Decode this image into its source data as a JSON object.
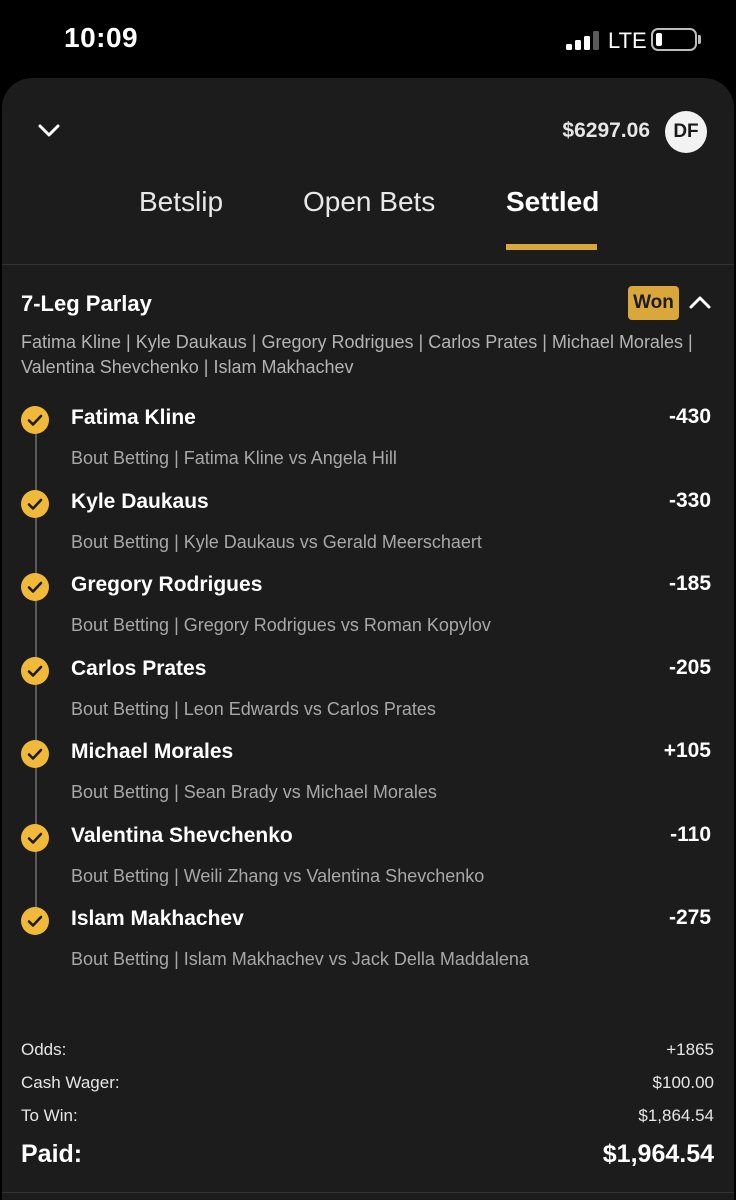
{
  "status_bar": {
    "time": "10:09",
    "network": "LTE"
  },
  "header": {
    "balance": "$6297.06",
    "avatar_initials": "DF"
  },
  "tabs": [
    {
      "label": "Betslip",
      "active": false
    },
    {
      "label": "Open Bets",
      "active": false
    },
    {
      "label": "Settled",
      "active": true
    }
  ],
  "parlay": {
    "title": "7-Leg Parlay",
    "status": "Won",
    "summary_line1": "Fatima Kline | Kyle Daukaus | Gregory Rodrigues | Carlos Prates | Michael Morales |",
    "summary_line2": "Valentina Shevchenko | Islam Makhachev",
    "legs": [
      {
        "name": "Fatima Kline",
        "odds": "-430",
        "description": "Bout Betting | Fatima Kline vs Angela Hill"
      },
      {
        "name": "Kyle Daukaus",
        "odds": "-330",
        "description": "Bout Betting | Kyle Daukaus vs Gerald Meerschaert"
      },
      {
        "name": "Gregory Rodrigues",
        "odds": "-185",
        "description": "Bout Betting | Gregory Rodrigues vs Roman Kopylov"
      },
      {
        "name": "Carlos Prates",
        "odds": "-205",
        "description": "Bout Betting | Leon Edwards vs Carlos Prates"
      },
      {
        "name": "Michael Morales",
        "odds": "+105",
        "description": "Bout Betting | Sean Brady vs Michael Morales"
      },
      {
        "name": "Valentina Shevchenko",
        "odds": "-110",
        "description": "Bout Betting | Weili Zhang vs Valentina Shevchenko"
      },
      {
        "name": "Islam Makhachev",
        "odds": "-275",
        "description": "Bout Betting | Islam Makhachev vs Jack Della Maddalena"
      }
    ]
  },
  "totals": {
    "odds_label": "Odds:",
    "odds_value": "+1865",
    "wager_label": "Cash Wager:",
    "wager_value": "$100.00",
    "to_win_label": "To Win:",
    "to_win_value": "$1,864.54",
    "paid_label": "Paid:",
    "paid_value": "$1,964.54"
  },
  "colors": {
    "accent": "#d9a73a",
    "check": "#f0b93a",
    "sheet_bg": "#1c1c1c"
  },
  "icons": [
    "chevron-down-icon",
    "chevron-up-icon",
    "check-circle-icon",
    "signal-icon",
    "battery-icon"
  ]
}
